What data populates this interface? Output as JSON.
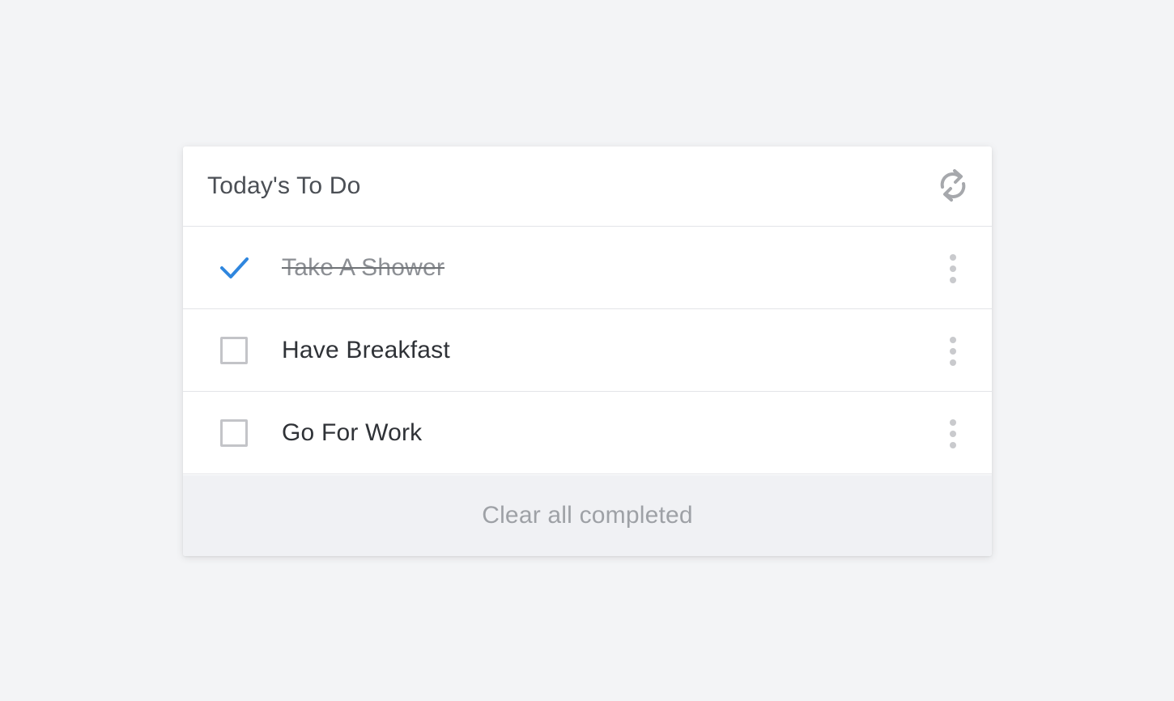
{
  "header": {
    "title": "Today's To Do",
    "refresh_icon": "refresh-icon"
  },
  "todos": [
    {
      "label": "Take A Shower",
      "completed": true
    },
    {
      "label": "Have Breakfast",
      "completed": false
    },
    {
      "label": "Go For Work",
      "completed": false
    }
  ],
  "footer": {
    "clear_label": "Clear all completed"
  },
  "colors": {
    "background": "#f3f4f6",
    "accent_check": "#2f86de",
    "checkbox_border": "#c3c4c8",
    "footer_bg": "#f0f1f4"
  },
  "icons": {
    "done": "checkmark-icon",
    "todo": "checkbox-unchecked-icon",
    "more": "more-vertical-icon"
  }
}
